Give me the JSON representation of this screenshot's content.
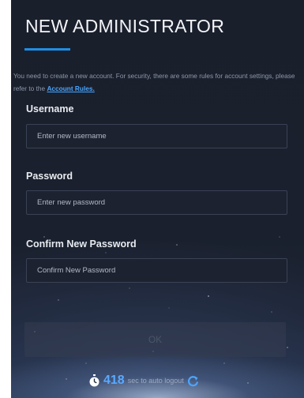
{
  "dialog": {
    "title": "NEW ADMINISTRATOR",
    "notice_text": "You need to create a new account. For security, there are some rules for account settings, please refer to the",
    "rules_link": "Account Rules."
  },
  "form": {
    "username": {
      "label": "Username",
      "placeholder": "Enter new username",
      "value": ""
    },
    "password": {
      "label": "Password",
      "placeholder": "Enter new password",
      "value": ""
    },
    "confirm": {
      "label": "Confirm New Password",
      "placeholder": "Confirm New Password",
      "value": ""
    }
  },
  "actions": {
    "ok_label": "OK",
    "ok_enabled": false
  },
  "timer": {
    "seconds": "418",
    "suffix": "sec to auto logout",
    "icons": [
      "stopwatch-icon",
      "refresh-icon"
    ]
  },
  "colors": {
    "accent": "#1e8fe3",
    "link": "#4aa6ff",
    "timer": "#5aa9ff",
    "panel_bg": "#1a1f2c"
  }
}
